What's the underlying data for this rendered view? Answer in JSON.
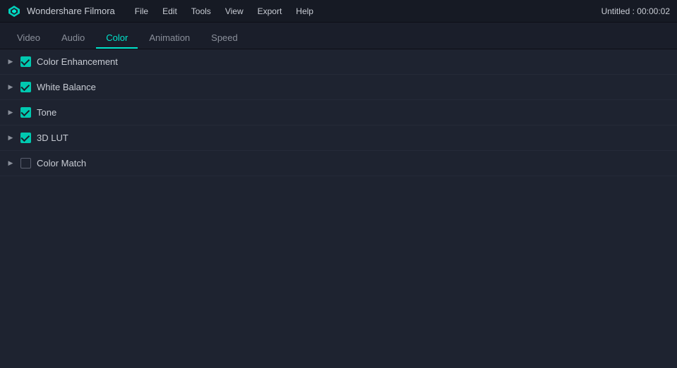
{
  "titlebar": {
    "app_name": "Wondershare Filmora",
    "window_title": "Untitled : 00:00:02",
    "menu_items": [
      "File",
      "Edit",
      "Tools",
      "View",
      "Export",
      "Help"
    ]
  },
  "tabs": [
    {
      "id": "video",
      "label": "Video",
      "active": false
    },
    {
      "id": "audio",
      "label": "Audio",
      "active": false
    },
    {
      "id": "color",
      "label": "Color",
      "active": true
    },
    {
      "id": "animation",
      "label": "Animation",
      "active": false
    },
    {
      "id": "speed",
      "label": "Speed",
      "active": false
    }
  ],
  "color_sections": [
    {
      "id": "color-enhancement",
      "label": "Color Enhancement",
      "checked": true
    },
    {
      "id": "white-balance",
      "label": "White Balance",
      "checked": true
    },
    {
      "id": "tone",
      "label": "Tone",
      "checked": true
    },
    {
      "id": "3d-lut",
      "label": "3D LUT",
      "checked": true
    },
    {
      "id": "color-match",
      "label": "Color Match",
      "checked": false
    }
  ],
  "colors": {
    "accent": "#00e5cc",
    "checkbox_active": "#00c9b0"
  }
}
